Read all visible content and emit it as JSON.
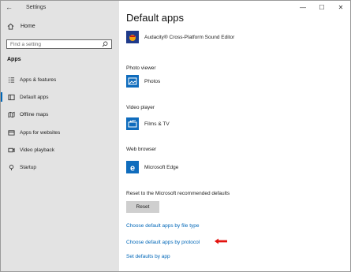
{
  "window": {
    "title": "Settings",
    "controls": {
      "minimize": "—",
      "maximize": "☐",
      "close": "✕"
    }
  },
  "sidebar": {
    "home_label": "Home",
    "search_placeholder": "Find a setting",
    "section_label": "Apps",
    "items": [
      {
        "label": "Apps & features",
        "icon": "apps-list-icon"
      },
      {
        "label": "Default apps",
        "icon": "default-apps-icon",
        "active": true
      },
      {
        "label": "Offline maps",
        "icon": "map-icon"
      },
      {
        "label": "Apps for websites",
        "icon": "website-icon"
      },
      {
        "label": "Video playback",
        "icon": "video-icon"
      },
      {
        "label": "Startup",
        "icon": "startup-icon"
      }
    ]
  },
  "main": {
    "title": "Default apps",
    "top_app": {
      "name": "Audacity® Cross-Platform Sound Editor",
      "icon": "audacity-icon"
    },
    "photo_viewer": {
      "label": "Photo viewer",
      "app": "Photos",
      "icon": "photos-icon"
    },
    "video_player": {
      "label": "Video player",
      "app": "Films & TV",
      "icon": "films-tv-icon"
    },
    "web_browser": {
      "label": "Web browser",
      "app": "Microsoft Edge",
      "icon": "edge-icon"
    },
    "reset_text": "Reset to the Microsoft recommended defaults",
    "reset_button": "Reset",
    "links": {
      "by_file_type": "Choose default apps by file type",
      "by_protocol": "Choose default apps by protocol",
      "set_by_app": "Set defaults by app"
    }
  },
  "colors": {
    "accent": "#0067b8",
    "sidebar_bg": "#e3e3e3",
    "tile_blue": "#0f6cbd",
    "arrow_red": "#e3130f"
  }
}
